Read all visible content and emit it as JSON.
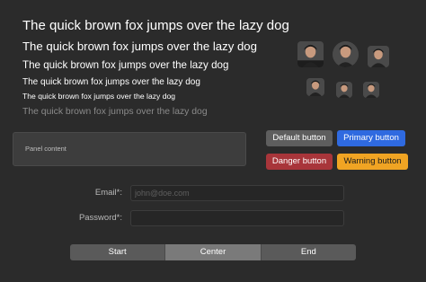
{
  "typography": {
    "sample_text": "The quick brown fox jumps over the lazy dog"
  },
  "avatars": {
    "icon": "person-photo"
  },
  "panel": {
    "label": "Panel content"
  },
  "buttons": {
    "default": "Default button",
    "primary": "Primary button",
    "danger": "Danger button",
    "warning": "Warning button"
  },
  "form": {
    "email_label": "Email*:",
    "email_placeholder": "john@doe.com",
    "password_label": "Password*:",
    "password_placeholder": ""
  },
  "segmented": {
    "items": [
      "Start",
      "Center",
      "End"
    ],
    "selected": "Center"
  },
  "colors": {
    "background": "#2b2b2b",
    "primary": "#2f6ae0",
    "danger": "#a8353a",
    "warning": "#f0a423",
    "default": "#5e5e5e"
  }
}
